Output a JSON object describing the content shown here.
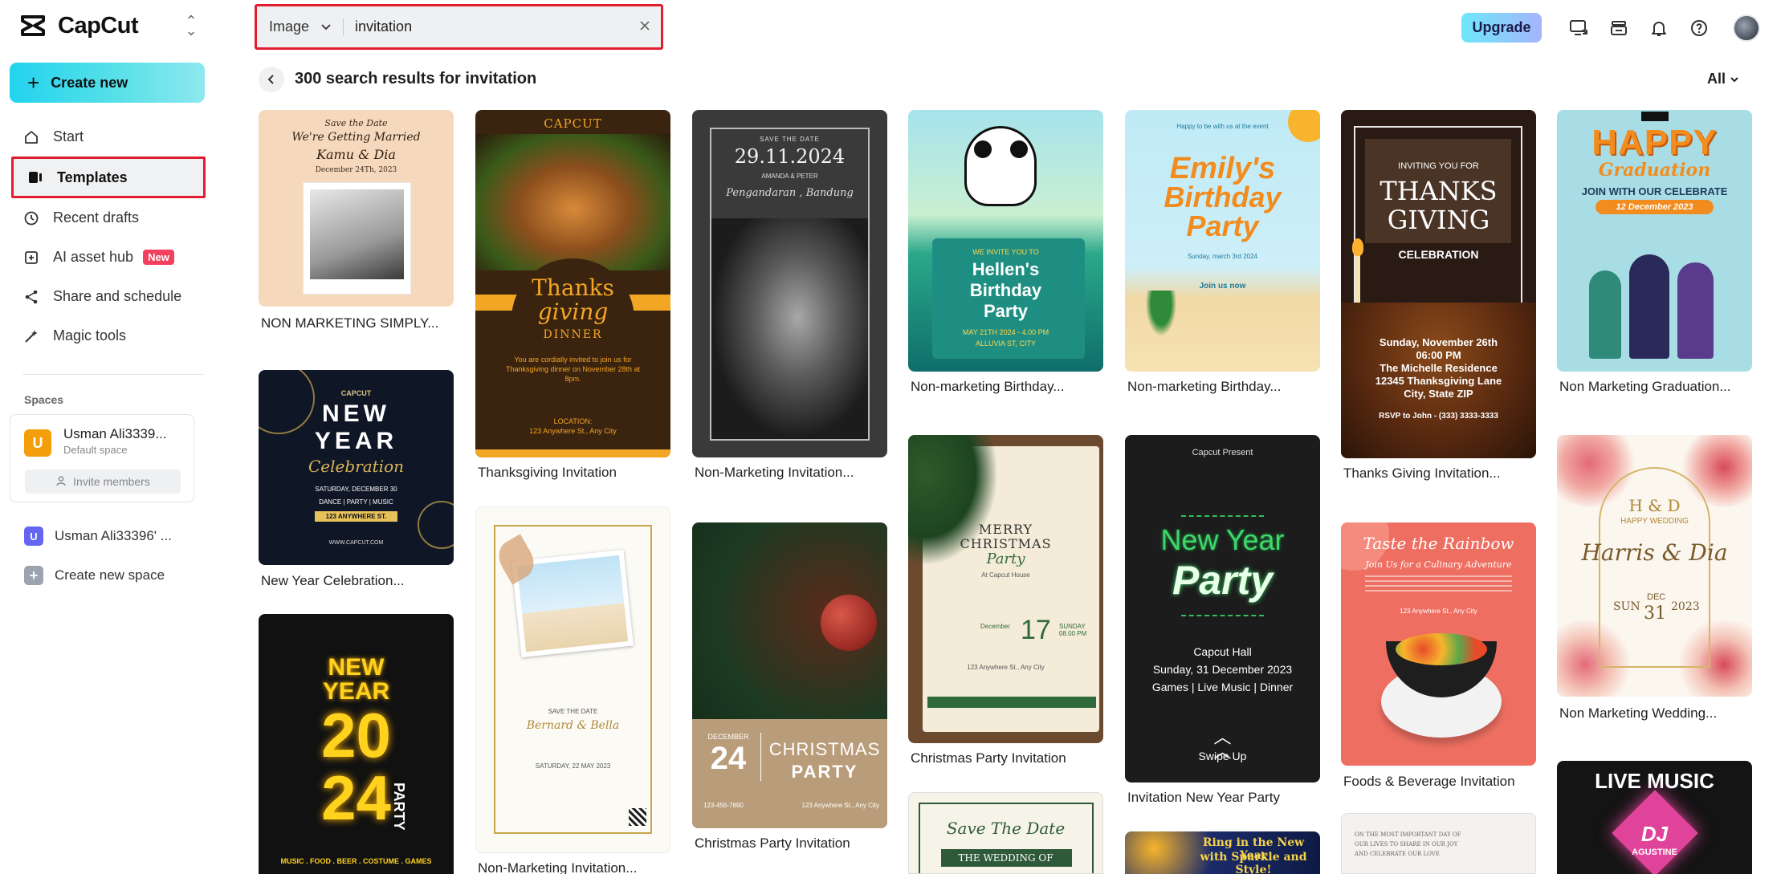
{
  "app": {
    "name": "CapCut"
  },
  "sidebar": {
    "create_label": "Create new",
    "items": [
      {
        "label": "Start",
        "icon": "home-icon"
      },
      {
        "label": "Templates",
        "icon": "templates-icon"
      },
      {
        "label": "Recent drafts",
        "icon": "clock-icon"
      },
      {
        "label": "AI asset hub",
        "icon": "asset-hub-icon",
        "badge": "New"
      },
      {
        "label": "Share and schedule",
        "icon": "share-icon"
      },
      {
        "label": "Magic tools",
        "icon": "magic-wand-icon"
      }
    ],
    "spaces_title": "Spaces",
    "space": {
      "avatar": "U",
      "name": "Usman Ali3339...",
      "sub": "Default space",
      "invite_label": "Invite members"
    },
    "other_space": {
      "avatar": "U",
      "name": "Usman Ali33396' ..."
    },
    "create_space_label": "Create new space"
  },
  "search": {
    "type": "Image",
    "value": "invitation"
  },
  "topbar": {
    "upgrade_label": "Upgrade"
  },
  "results": {
    "title": "300 search results for invitation",
    "filter": "All"
  },
  "cards": [
    {
      "label": "NON MARKETING SIMPLY...",
      "texts": [
        "Save the Date",
        "We're Getting Married",
        "Kamu & Dia",
        "December 24Th, 2023"
      ]
    },
    {
      "label": "New Year Celebration...",
      "texts": [
        "CAPCUT",
        "NEW",
        "YEAR",
        "Celebration",
        "SATURDAY, DECEMBER 30",
        "DANCE | PARTY | MUSIC",
        "123 ANYWHERE ST.",
        "WWW.CAPCUT.COM"
      ]
    },
    {
      "label": "",
      "texts": [
        "NEW",
        "YEAR",
        "20",
        "24",
        "PARTY",
        "MUSIC . FOOD . BEER . COSTUME . GAMES"
      ]
    },
    {
      "label": "Thanksgiving Invitation",
      "texts": [
        "CAPCUT",
        "Thanks",
        "giving",
        "DINNER",
        "You are cordially invited to join us for Thanksgiving dinner on November 28th at 8pm.",
        "LOCATION:",
        "123 Anywhere St., Any City"
      ]
    },
    {
      "label": "Non-Marketing Invitation...",
      "texts": [
        "SAVE THE DATE",
        "Bernard & Bella",
        "SATURDAY, 22 MAY 2023"
      ]
    },
    {
      "label": "Non-Marketing Invitation...",
      "texts": [
        "SAVE THE DATE",
        "29.11.2024",
        "AMANDA & PETER",
        "Pengandaran , Bandung"
      ]
    },
    {
      "label": "Christmas Party Invitation",
      "texts": [
        "DECEMBER",
        "24",
        "CHRISTMAS",
        "PARTY",
        "123-456-7890",
        "123 Anywhere St., Any City"
      ]
    },
    {
      "label": "Non-marketing Birthday...",
      "texts": [
        "WE INVITE YOU TO",
        "Hellen's",
        "Birthday",
        "Party",
        "MAY 21TH 2024 - 4.00 PM",
        "ALLUVIA ST, CITY"
      ]
    },
    {
      "label": "Christmas Party Invitation",
      "texts": [
        "MERRY",
        "CHRISTMAS",
        "Party",
        "At Capcut House",
        "December",
        "17",
        "SUNDAY 08.00 PM",
        "123 Anywhere St., Any City"
      ]
    },
    {
      "label": "",
      "texts": [
        "Save The Date",
        "THE WEDDING OF"
      ]
    },
    {
      "label": "Non-marketing Birthday...",
      "texts": [
        "Happy to be with us at the event",
        "Emily's",
        "Birthday",
        "Party",
        "Sunday, march 3rd 2024",
        "Join us now"
      ]
    },
    {
      "label": "Invitation New Year Party",
      "texts": [
        "Capcut Present",
        "New Year",
        "Party",
        "Capcut Hall",
        "Sunday, 31 December 2023",
        "Games | Live Music | Dinner",
        "Swipe Up"
      ]
    },
    {
      "label": "",
      "texts": [
        "Ring in the New Year",
        "with Sparkle and Style!"
      ]
    },
    {
      "label": "Thanks Giving Invitation...",
      "texts": [
        "INVITING YOU FOR",
        "THANKS",
        "GIVING",
        "CELEBRATION",
        "Sunday, November 26th",
        "06:00 PM",
        "The Michelle Residence",
        "12345 Thanksgiving Lane",
        "City, State ZIP",
        "RSVP to John - (333) 3333-3333"
      ]
    },
    {
      "label": "Foods & Beverage Invitation",
      "texts": [
        "Taste the Rainbow",
        "Join Us for a Culinary Adventure",
        "123 Anywhere St., Any City"
      ]
    },
    {
      "label": "",
      "texts": [
        "ON THE MOST IMPORTANT DAY OF",
        "OUR LIVES TO SHARE IN OUR JOY",
        "AND CELEBRATE OUR LOVE"
      ]
    },
    {
      "label": "Non Marketing Graduation...",
      "texts": [
        "HAPPY",
        "Graduation",
        "JOIN WITH OUR CELEBRATE",
        "12 December 2023"
      ]
    },
    {
      "label": "Non Marketing Wedding...",
      "texts": [
        "H & D",
        "HAPPY WEDDING",
        "Harris & Dia",
        "SUN",
        "DEC",
        "31",
        "2023"
      ]
    },
    {
      "label": "",
      "texts": [
        "LIVE MUSIC",
        "DJ",
        "AGUSTINE"
      ]
    }
  ]
}
